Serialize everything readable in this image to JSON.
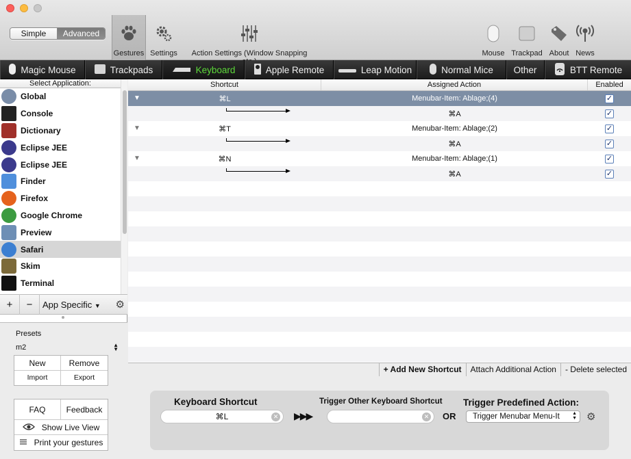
{
  "window": {
    "mode_toggle": {
      "simple": "Simple",
      "advanced": "Advanced"
    }
  },
  "toolbar": {
    "gestures": "Gestures",
    "settings": "Settings",
    "action_settings": "Action Settings (Window Snapping etc.)",
    "mouse": "Mouse",
    "trackpad": "Trackpad",
    "about": "About",
    "news": "News"
  },
  "device_tabs": [
    {
      "label": "Magic Mouse",
      "icon": "mouse-icon"
    },
    {
      "label": "Trackpads",
      "icon": "trackpad-icon"
    },
    {
      "label": "Keyboard",
      "icon": "keyboard-icon"
    },
    {
      "label": "Apple Remote",
      "icon": "remote-icon"
    },
    {
      "label": "Leap Motion",
      "icon": "leap-icon"
    },
    {
      "label": "Normal Mice",
      "icon": "mouse-icon"
    },
    {
      "label": "Other",
      "icon": ""
    },
    {
      "label": "BTT Remote",
      "icon": "btt-remote-icon"
    }
  ],
  "sidebar": {
    "header": "Select Application:",
    "apps": [
      {
        "name": "Global",
        "icon": "globe-icon",
        "color": "#7a8da8"
      },
      {
        "name": "Console",
        "icon": "console-icon",
        "color": "#222222"
      },
      {
        "name": "Dictionary",
        "icon": "dictionary-icon",
        "color": "#a0302a"
      },
      {
        "name": "Eclipse JEE",
        "icon": "eclipse-icon",
        "color": "#3b3a8c"
      },
      {
        "name": "Eclipse JEE",
        "icon": "eclipse-icon",
        "color": "#3b3a8c"
      },
      {
        "name": "Finder",
        "icon": "finder-icon",
        "color": "#4f8fdc"
      },
      {
        "name": "Firefox",
        "icon": "firefox-icon",
        "color": "#e5621d"
      },
      {
        "name": "Google Chrome",
        "icon": "chrome-icon",
        "color": "#3c9b41"
      },
      {
        "name": "Preview",
        "icon": "preview-icon",
        "color": "#6e8fb5"
      },
      {
        "name": "Safari",
        "icon": "safari-icon",
        "color": "#3c7fd1"
      },
      {
        "name": "Skim",
        "icon": "skim-icon",
        "color": "#7c6a3a"
      },
      {
        "name": "Terminal",
        "icon": "terminal-icon",
        "color": "#111111"
      }
    ],
    "selected_app": "Safari",
    "add_label": "+",
    "remove_label": "−",
    "app_specific_label": "App Specific",
    "presets": {
      "label": "Presets",
      "selected": "m2",
      "new": "New",
      "remove": "Remove",
      "import": "Import",
      "export": "Export"
    },
    "faq": "FAQ",
    "feedback": "Feedback",
    "show_live_view": "Show Live View",
    "print_gestures": "Print your gestures"
  },
  "table": {
    "columns": [
      "Shortcut",
      "Assigned Action",
      "Enabled"
    ],
    "rows": [
      {
        "shortcut": "⌘L",
        "action": "Menubar-Item: Ablage;(4)",
        "enabled": true,
        "kind": "parent",
        "selected": true
      },
      {
        "shortcut": "",
        "action": "⌘A",
        "enabled": true,
        "kind": "child"
      },
      {
        "shortcut": "⌘T",
        "action": "Menubar-Item: Ablage;(2)",
        "enabled": true,
        "kind": "parent"
      },
      {
        "shortcut": "",
        "action": "⌘A",
        "enabled": true,
        "kind": "child"
      },
      {
        "shortcut": "⌘N",
        "action": "Menubar-Item: Ablage;(1)",
        "enabled": true,
        "kind": "parent"
      },
      {
        "shortcut": "",
        "action": "⌘A",
        "enabled": true,
        "kind": "child"
      }
    ]
  },
  "actions": {
    "add_new_shortcut": "+ Add New Shortcut",
    "attach_additional": "Attach Additional Action",
    "delete_selected": "- Delete selected"
  },
  "editor": {
    "keyboard_shortcut_label": "Keyboard Shortcut",
    "keyboard_shortcut_value": "⌘L",
    "trigger_other_label": "Trigger Other Keyboard Shortcut",
    "trigger_other_value": "",
    "or_label": "OR",
    "predefined_label": "Trigger Predefined Action:",
    "predefined_value": "Trigger Menubar Menu-It"
  },
  "colors": {
    "active_tab_text": "#5dd93a",
    "selected_row": "#7d8ea5"
  }
}
